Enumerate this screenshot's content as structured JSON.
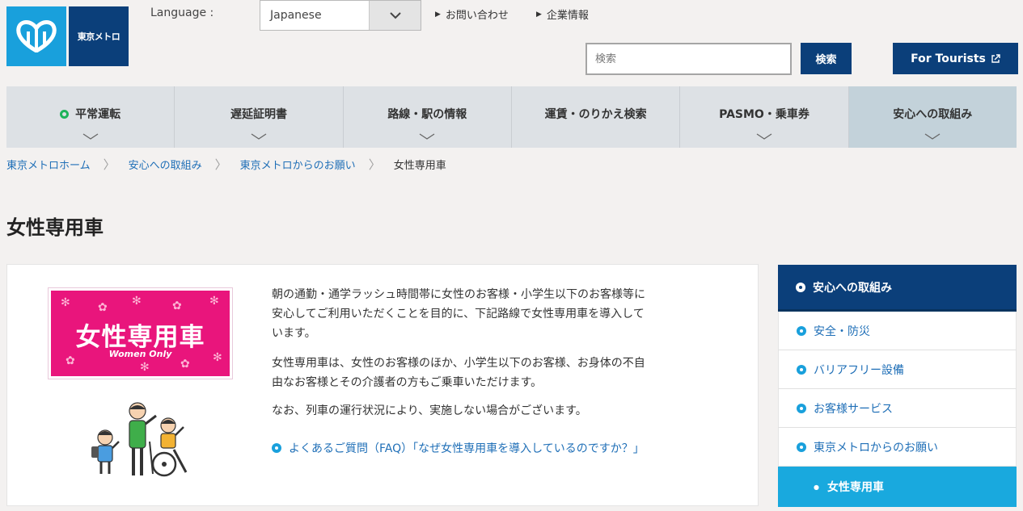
{
  "header": {
    "logo_text": "東京メトロ",
    "language_label": "Language :",
    "language_value": "Japanese",
    "links": [
      "お問い合わせ",
      "企業情報"
    ],
    "search_placeholder": "検索",
    "search_button": "検索",
    "tourists_button": "For Tourists"
  },
  "nav": {
    "items": [
      {
        "label": "平常運転"
      },
      {
        "label": "遅延証明書"
      },
      {
        "label": "路線・駅の情報"
      },
      {
        "label": "運賃・のりかえ検索"
      },
      {
        "label": "PASMO・乗車券"
      },
      {
        "label": "安心への取組み"
      }
    ]
  },
  "breadcrumb": [
    "東京メトロホーム",
    "安心への取組み",
    "東京メトロからのお願い",
    "女性専用車"
  ],
  "page_title": "女性専用車",
  "banner": {
    "jp": "女性専用車",
    "en": "Women Only"
  },
  "content": {
    "p1": [
      "朝の通勤・通学ラッシュ時間帯に女性のお客様・小学生以下のお客様等に",
      "安心してご利用いただくことを目的に、下記路線で女性専用車を導入して",
      "います。"
    ],
    "p2": [
      "女性専用車は、女性のお客様のほか、小学生以下のお客様、お身体の不自",
      "由なお客様とその介護者の方もご乗車いただけます。"
    ],
    "p3": "なお、列車の運行状況により、実施しない場合がございます。",
    "faq": "よくあるご質問（FAQ）「なぜ女性専用車を導入しているのですか？」"
  },
  "sidebar": {
    "header": "安心への取組み",
    "items": [
      "安全・防災",
      "バリアフリー設備",
      "お客様サービス",
      "東京メトロからのお願い"
    ],
    "active": "女性専用車"
  },
  "colors": {
    "navy": "#0b3f7a",
    "sky": "#19a0dc",
    "pink": "#e9157c",
    "green": "#1eb35a"
  }
}
